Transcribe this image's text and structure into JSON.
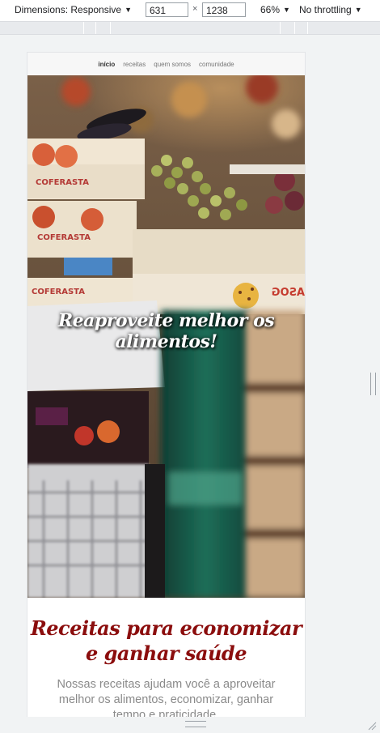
{
  "devtools": {
    "dimensions_label": "Dimensions: Responsive",
    "width": "631",
    "times": "×",
    "height": "1238",
    "zoom": "66%",
    "throttling": "No throttling"
  },
  "site": {
    "nav": [
      "início",
      "receitas",
      "quem somos",
      "comunidade"
    ],
    "hero_title": "Reaproveite melhor os alimentos!",
    "section_title": "Receitas para economizar e ganhar saúde",
    "section_text": "Nossas receitas ajudam você a aproveitar melhor os alimentos, economizar, ganhar tempo e praticidade."
  },
  "crate_labels": [
    "COFERASTA",
    "COFERASTA",
    "COFERASTA",
    "ASOG"
  ],
  "colors": {
    "accent": "#8b0d0d",
    "toolbar_bg": "#ffffff",
    "page_bg": "#f1f3f4"
  }
}
